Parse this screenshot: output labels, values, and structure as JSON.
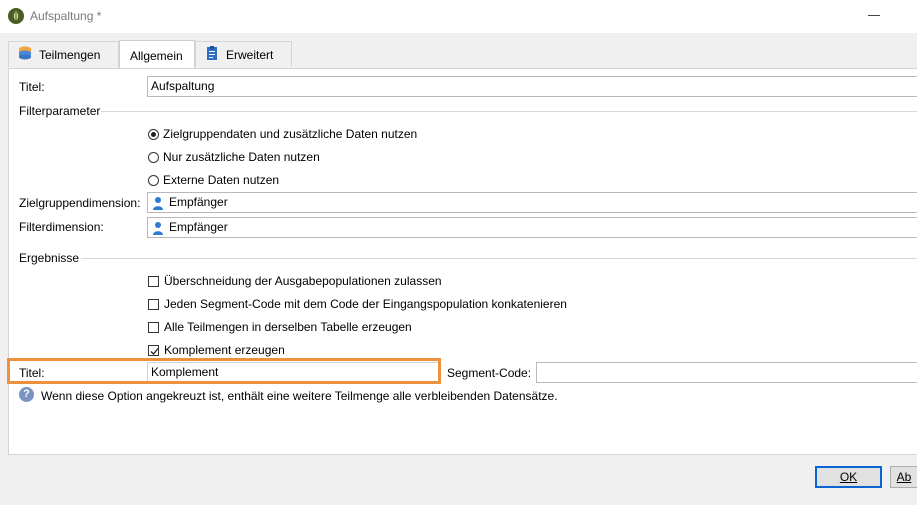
{
  "window": {
    "title": "Aufspaltung *"
  },
  "tabs": [
    {
      "label": "Teilmengen",
      "icon": "database-icon"
    },
    {
      "label": "Allgemein",
      "icon": null,
      "active": true
    },
    {
      "label": "Erweitert",
      "icon": "clipboard-icon"
    }
  ],
  "form": {
    "title_label": "Titel:",
    "title_value": "Aufspaltung",
    "filter_section": "Filterparameter",
    "radio_options": [
      {
        "label": "Zielgruppendaten und zusätzliche Daten nutzen",
        "selected": true
      },
      {
        "label": "Nur zusätzliche Daten nutzen",
        "selected": false
      },
      {
        "label": "Externe Daten nutzen",
        "selected": false
      }
    ],
    "target_dimension_label": "Zielgruppendimension:",
    "target_dimension_value": "Empfänger",
    "filter_dimension_label": "Filterdimension:",
    "filter_dimension_value": "Empfänger",
    "results_section": "Ergebnisse",
    "checkboxes": [
      {
        "label": "Überschneidung der Ausgabepopulationen zulassen",
        "checked": false
      },
      {
        "label": "Jeden Segment-Code mit dem Code der Eingangspopulation konkatenieren",
        "checked": false
      },
      {
        "label": "Alle Teilmengen in derselben Tabelle erzeugen",
        "checked": false
      },
      {
        "label": "Komplement erzeugen",
        "checked": true
      }
    ],
    "complement_title_label": "Titel:",
    "complement_title_value": "Komplement",
    "segment_code_label": "Segment-Code:",
    "segment_code_value": "",
    "info_text": "Wenn diese Option angekreuzt ist, enthält eine weitere Teilmenge alle verbleibenden Datensätze."
  },
  "buttons": {
    "ok": "OK",
    "cancel_partial": "Ab"
  },
  "colors": {
    "highlight": "#ee913e",
    "default_button_border": "#0a64d4",
    "person_icon": "#2b7bd4"
  }
}
